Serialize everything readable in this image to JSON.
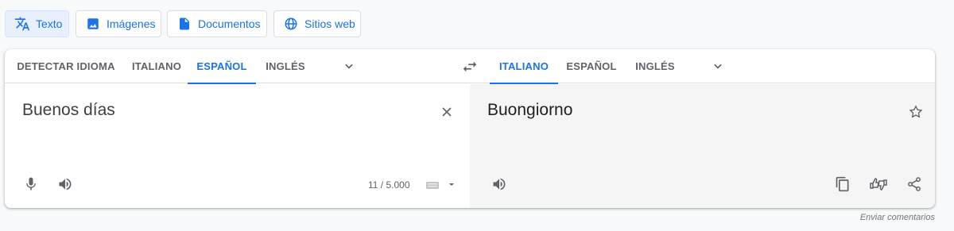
{
  "modes": [
    {
      "label": "Texto",
      "icon": "translate-icon",
      "active": true
    },
    {
      "label": "Imágenes",
      "icon": "image-icon",
      "active": false
    },
    {
      "label": "Documentos",
      "icon": "document-icon",
      "active": false
    },
    {
      "label": "Sitios web",
      "icon": "globe-icon",
      "active": false
    }
  ],
  "source_langs": [
    "DETECTAR IDIOMA",
    "ITALIANO",
    "ESPAÑOL",
    "INGLÉS"
  ],
  "source_selected": "ESPAÑOL",
  "target_langs": [
    "ITALIANO",
    "ESPAÑOL",
    "INGLÉS"
  ],
  "target_selected": "ITALIANO",
  "source": {
    "text": "Buenos días",
    "char_count": "11 / 5.000"
  },
  "target": {
    "text": "Buongiorno"
  },
  "feedback": "Enviar comentarios",
  "colors": {
    "accent": "#1a73e8",
    "icon_gray": "#5f6368",
    "target_bg": "#f5f5f5"
  }
}
